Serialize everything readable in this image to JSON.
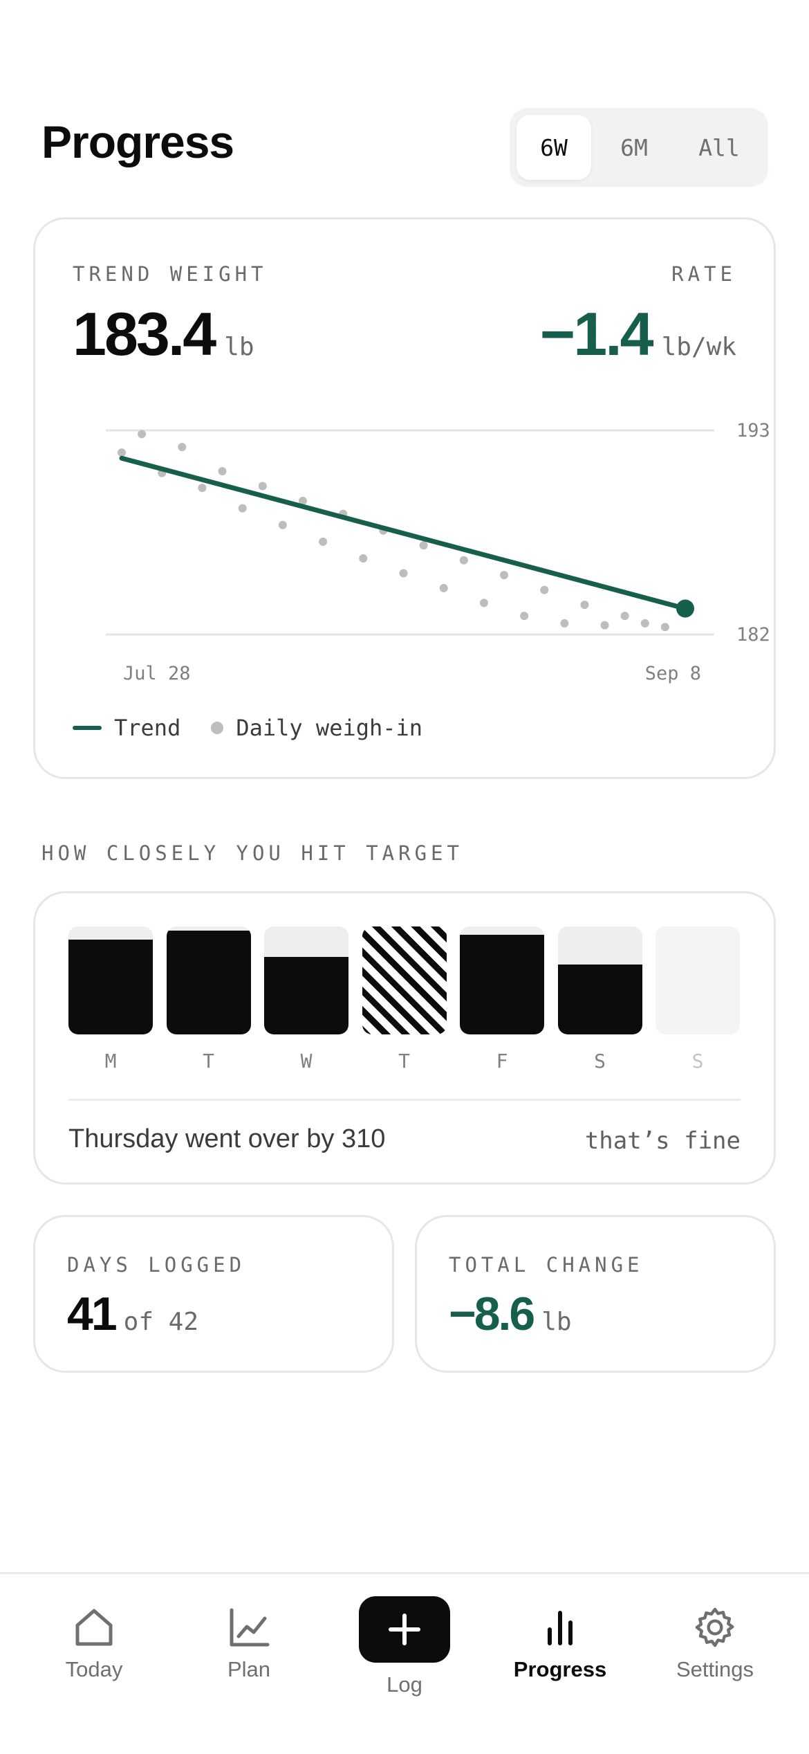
{
  "header": {
    "title": "Progress"
  },
  "range_tabs": [
    {
      "label": "6W",
      "active": true
    },
    {
      "label": "6M",
      "active": false
    },
    {
      "label": "All",
      "active": false
    }
  ],
  "trend_card": {
    "trend_label": "TREND WEIGHT",
    "trend_value": "183.4",
    "trend_unit": "lb",
    "rate_label": "RATE",
    "rate_value": "−1.4",
    "rate_unit": "lb/wk",
    "legend_trend": "Trend",
    "legend_daily": "Daily weigh-in"
  },
  "chart_data": {
    "type": "line",
    "x_labels": [
      "Jul 28",
      "Sep 8"
    ],
    "y_ticks": [
      "193",
      "182"
    ],
    "ylim": [
      182,
      193
    ],
    "grid": true,
    "legend": "bottom-left",
    "series": [
      {
        "name": "Trend",
        "x": [
          0,
          42
        ],
        "y": [
          191.5,
          183.4
        ],
        "color": "#155f4c"
      },
      {
        "name": "Daily weigh-in",
        "x": [
          0,
          1.5,
          3,
          4.5,
          6,
          7.5,
          9,
          10.5,
          12,
          13.5,
          15,
          16.5,
          18,
          19.5,
          21,
          22.5,
          24,
          25.5,
          27,
          28.5,
          30,
          31.5,
          33,
          34.5,
          36,
          37.5,
          39,
          40.5
        ],
        "y": [
          191.8,
          192.8,
          190.7,
          192.1,
          189.9,
          190.8,
          188.8,
          190.0,
          187.9,
          189.2,
          187.0,
          188.5,
          186.1,
          187.6,
          185.3,
          186.8,
          184.5,
          186.0,
          183.7,
          185.2,
          183.0,
          184.4,
          182.6,
          183.6,
          182.5,
          183.0,
          182.6,
          182.4
        ],
        "color": "#bdbdbb"
      }
    ]
  },
  "target_section": {
    "heading": "HOW CLOSELY YOU HIT TARGET",
    "days": [
      {
        "label": "M",
        "fill": 0.88,
        "state": "under"
      },
      {
        "label": "T",
        "fill": 0.96,
        "state": "under"
      },
      {
        "label": "W",
        "fill": 0.72,
        "state": "under"
      },
      {
        "label": "T",
        "fill": 1.0,
        "state": "over"
      },
      {
        "label": "F",
        "fill": 0.92,
        "state": "under"
      },
      {
        "label": "S",
        "fill": 0.65,
        "state": "under"
      },
      {
        "label": "S",
        "fill": 0,
        "state": "empty"
      }
    ],
    "note": "Thursday went over by 310",
    "note_aside": "that’s fine"
  },
  "stats": {
    "days_logged_label": "DAYS LOGGED",
    "days_logged_value": "41",
    "days_logged_suffix": "of 42",
    "total_change_label": "TOTAL CHANGE",
    "total_change_value": "−8.6",
    "total_change_unit": "lb"
  },
  "tabbar": {
    "today": "Today",
    "plan": "Plan",
    "log": "Log",
    "progress": "Progress",
    "settings": "Settings",
    "active": "progress"
  },
  "colors": {
    "accent": "#155f4c",
    "ink": "#0c0c0c",
    "muted": "#6a6a6a"
  }
}
